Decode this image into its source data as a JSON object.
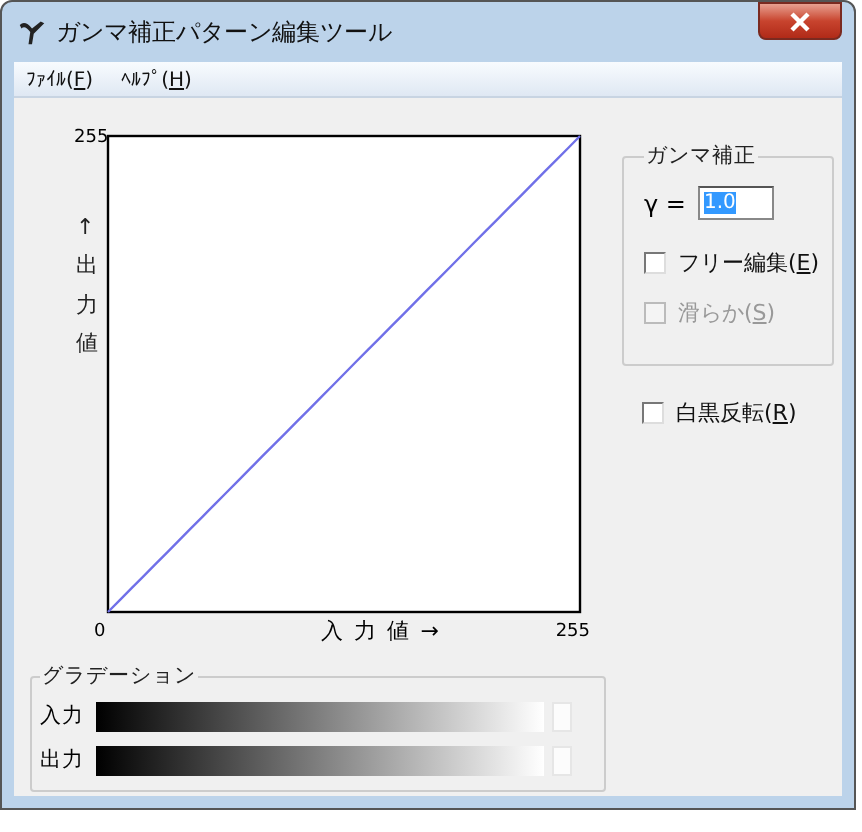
{
  "window": {
    "title": "ガンマ補正パターン編集ツール"
  },
  "menu": [
    {
      "prefix": "ﾌｧｲﾙ(",
      "key": "F",
      "suffix": ")"
    },
    {
      "prefix": "ﾍﾙﾌﾟ(",
      "key": "H",
      "suffix": ")"
    }
  ],
  "graph": {
    "y_max_label": "255",
    "y_label": "↑出力値",
    "x_min_label": "0",
    "x_label": "入 力 値 →",
    "x_max_label": "255"
  },
  "gamma_group": {
    "title": "ガンマ補正",
    "gamma_label": "γ =",
    "gamma_value": "1.0",
    "value_selected": true,
    "options": [
      {
        "prefix": "フリー編集(",
        "key": "E",
        "suffix": ")",
        "checked": false,
        "disabled": false
      },
      {
        "prefix": "滑らか(",
        "key": "S",
        "suffix": ")",
        "checked": false,
        "disabled": true
      }
    ]
  },
  "invert": {
    "prefix": "白黒反転(",
    "key": "R",
    "suffix": ")",
    "checked": false,
    "disabled": false
  },
  "gradation": {
    "title": "グラデーション",
    "rows": [
      {
        "label": "入力"
      },
      {
        "label": "出力"
      }
    ]
  }
}
